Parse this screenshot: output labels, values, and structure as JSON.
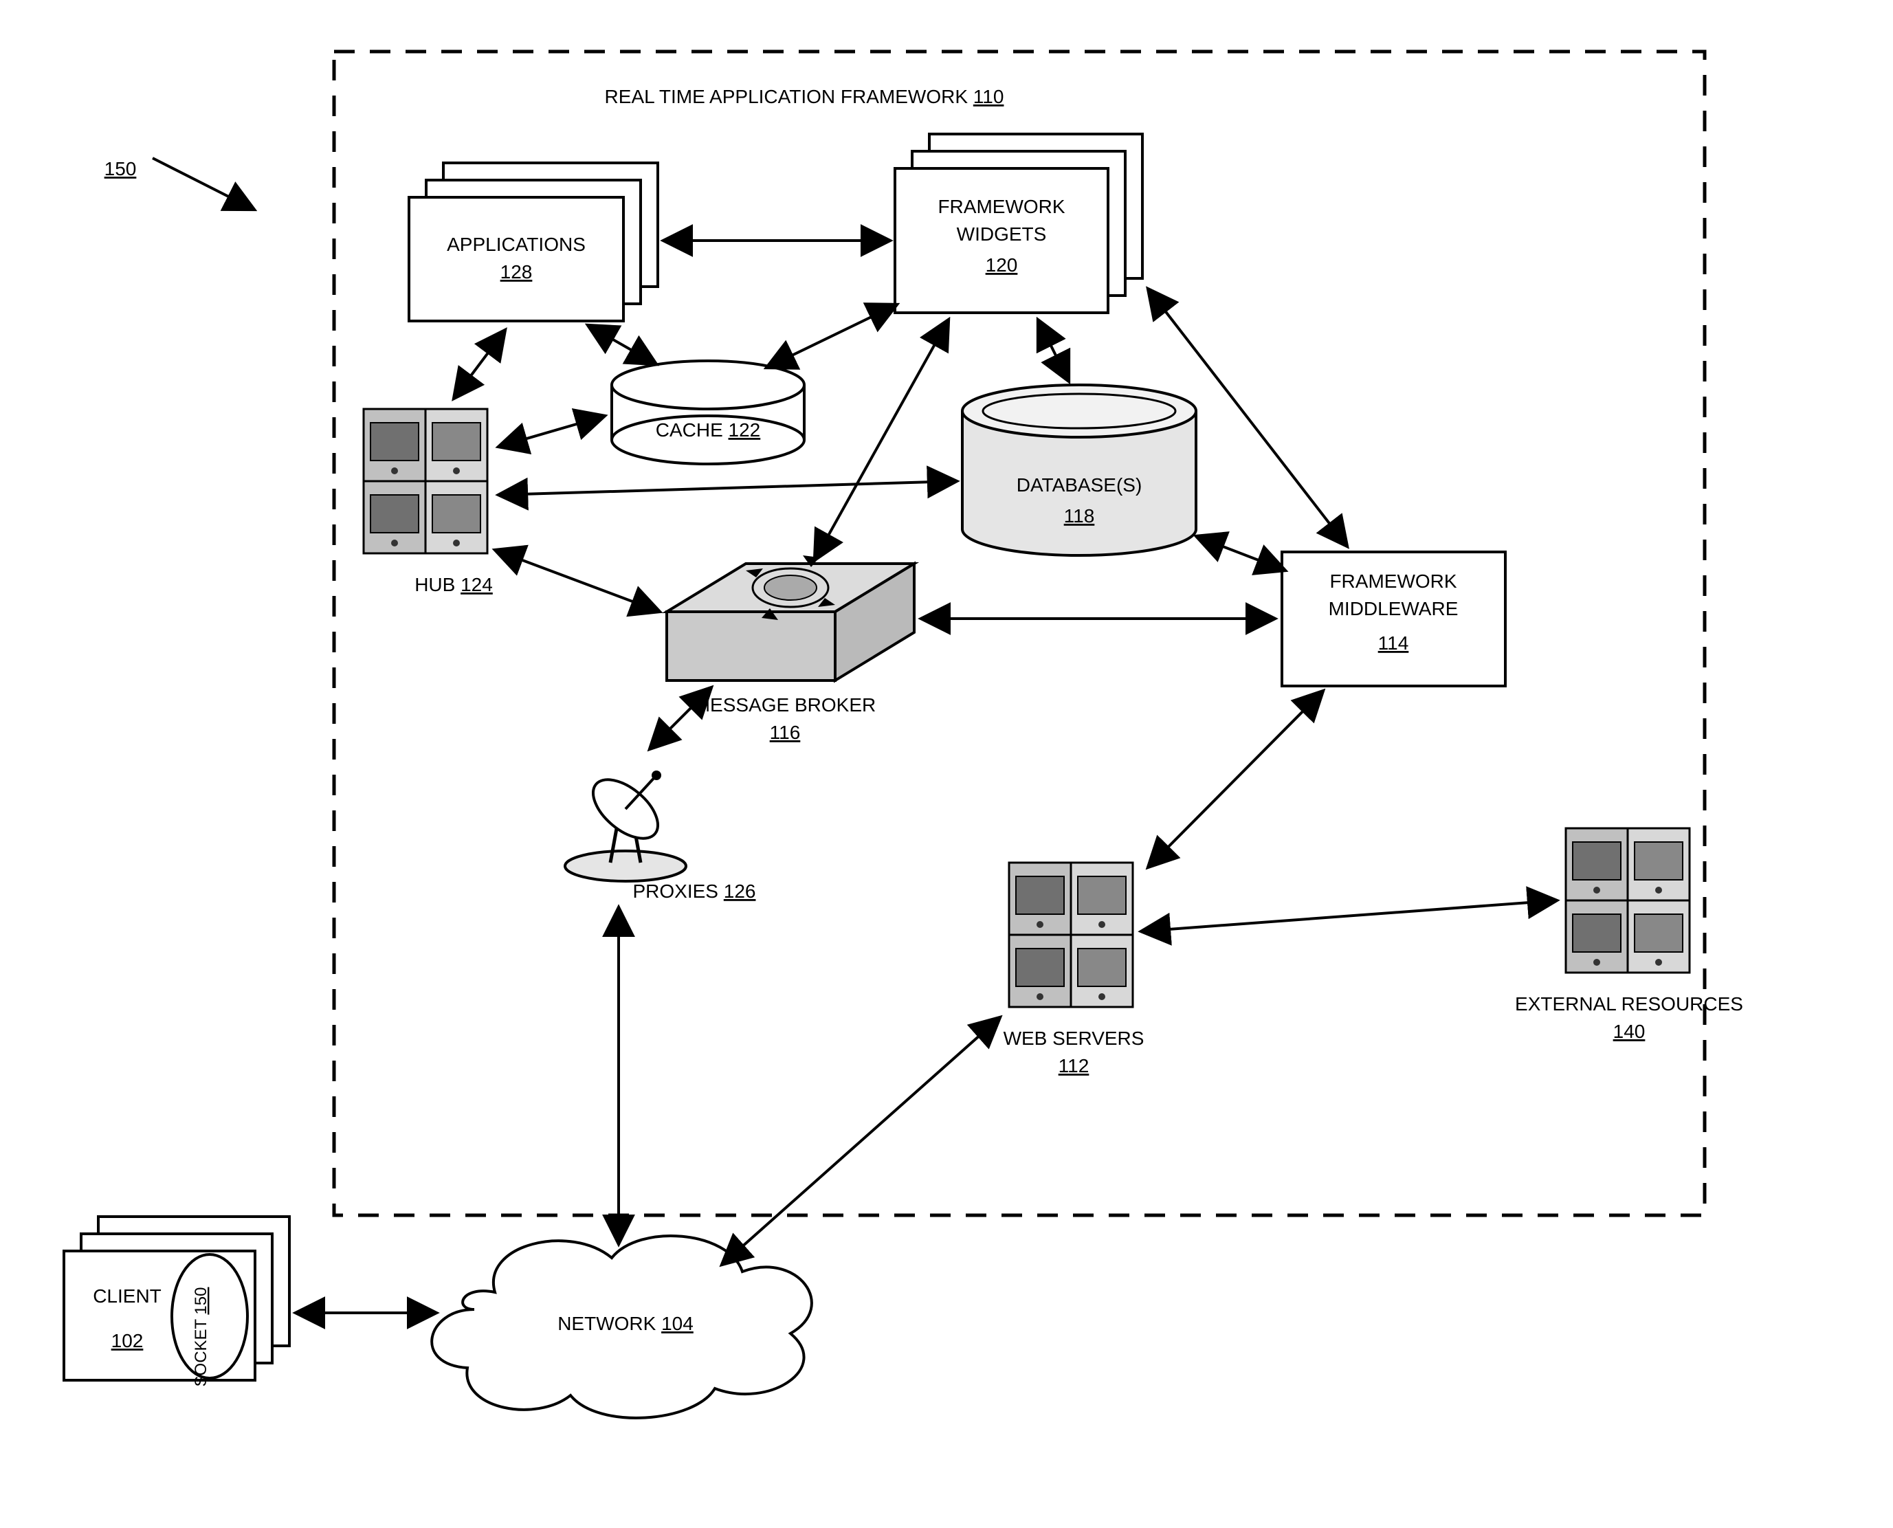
{
  "figure": {
    "ref": "150",
    "frame": {
      "title": "REAL TIME APPLICATION FRAMEWORK",
      "ref": "110"
    },
    "nodes": {
      "applications": {
        "label": "APPLICATIONS",
        "ref": "128"
      },
      "framework_widgets": {
        "label1": "FRAMEWORK",
        "label2": "WIDGETS",
        "ref": "120"
      },
      "cache": {
        "label": "CACHE",
        "ref": "122"
      },
      "hub": {
        "label": "HUB",
        "ref": "124"
      },
      "databases": {
        "label": "DATABASE(S)",
        "ref": "118"
      },
      "framework_middleware": {
        "label1": "FRAMEWORK",
        "label2": "MIDDLEWARE",
        "ref": "114"
      },
      "message_broker": {
        "label": "MESSAGE BROKER",
        "ref": "116"
      },
      "proxies": {
        "label": "PROXIES",
        "ref": "126"
      },
      "web_servers": {
        "label": "WEB SERVERS",
        "ref": "112"
      },
      "external_resources": {
        "label": "EXTERNAL RESOURCES",
        "ref": "140"
      },
      "client": {
        "label": "CLIENT",
        "ref": "102"
      },
      "socket": {
        "label": "SOCKET",
        "ref": "150"
      },
      "network": {
        "label": "NETWORK",
        "ref": "104"
      }
    }
  }
}
